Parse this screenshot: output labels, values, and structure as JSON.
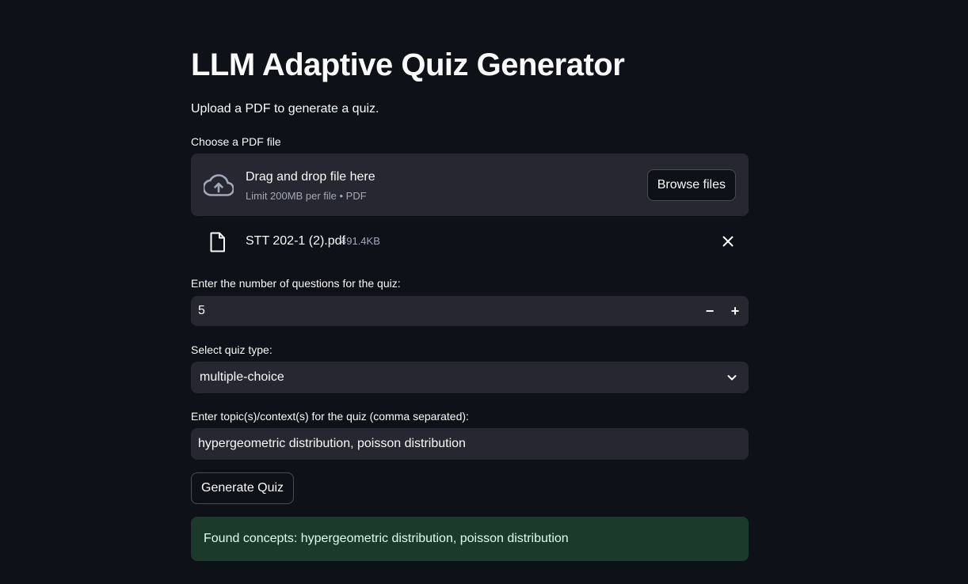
{
  "header": {
    "title": "LLM Adaptive Quiz Generator",
    "subtitle": "Upload a PDF to generate a quiz."
  },
  "uploader": {
    "label": "Choose a PDF file",
    "drop_title": "Drag and drop file here",
    "limit_text": "Limit 200MB per file • PDF",
    "browse_label": "Browse files",
    "icon": "cloud-upload-icon",
    "file": {
      "name": "STT 202-1 (2).pdf",
      "size": "491.4KB",
      "icon": "file-icon",
      "remove_icon": "close-icon"
    }
  },
  "num_questions": {
    "label": "Enter the number of questions for the quiz:",
    "value": "5",
    "minus": "−",
    "plus": "+"
  },
  "quiz_type": {
    "label": "Select quiz type:",
    "value": "multiple-choice",
    "icon": "chevron-down-icon"
  },
  "topics": {
    "label": "Enter topic(s)/context(s) for the quiz (comma separated):",
    "value": "hypergeometric distribution, poisson distribution"
  },
  "generate": {
    "label": "Generate Quiz"
  },
  "result": {
    "message": "Found concepts: hypergeometric distribution, poisson distribution"
  },
  "colors": {
    "background": "#0e1117",
    "widget_bg": "#262730",
    "success_bg": "#1b3a2b",
    "text": "#fafafa",
    "muted_text": "#a3a8b8"
  }
}
